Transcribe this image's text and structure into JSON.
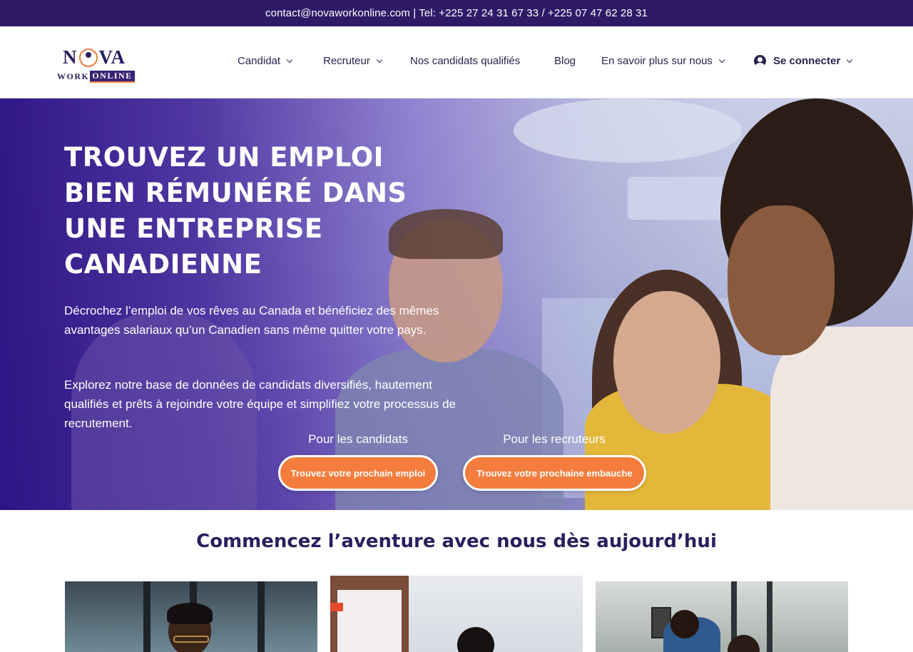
{
  "topbar": {
    "contact": "contact@novaworkonline.com | Tel: +225 27 24 31 67 33 / +225 07 47 62 28 31"
  },
  "logo": {
    "top_left": "N",
    "top_right": "VA",
    "work": "WORK",
    "online": "ONLINE"
  },
  "nav": {
    "items": [
      {
        "label": "Candidat",
        "has_dropdown": true
      },
      {
        "label": "Recruteur",
        "has_dropdown": true
      },
      {
        "label": "Nos candidats qualifiés",
        "has_dropdown": false
      },
      {
        "label": "Blog",
        "has_dropdown": false
      },
      {
        "label": "En savoir plus sur nous",
        "has_dropdown": true
      }
    ],
    "login": {
      "label": "Se connecter",
      "icon": "user-circle-icon"
    }
  },
  "hero": {
    "title": "TROUVEZ UN EMPLOI BIEN RÉMUNÉRÉ DANS UNE ENTREPRISE CANADIENNE",
    "paragraph1": "Décrochez l’emploi de vos rêves au Canada et bénéficiez des mêmes avantages salariaux qu’un Canadien sans même quitter votre pays.",
    "paragraph2": "Explorez notre base de données de candidats diversifiés, hautement qualifiés et prêts à rejoindre votre équipe et simplifiez votre processus de recrutement.",
    "cta_candidates": {
      "label": "Pour les candidats",
      "button": "Trouvez votre prochain emploi"
    },
    "cta_recruiters": {
      "label": "Pour les recruteurs",
      "button": "Trouvez votre prochaine embauche"
    }
  },
  "section": {
    "title": "Commencez l’aventure avec nous dès aujourd’hui"
  },
  "colors": {
    "brand_purple": "#2e1a66",
    "accent_orange": "#f47c3c",
    "text_dark": "#2a2350"
  }
}
